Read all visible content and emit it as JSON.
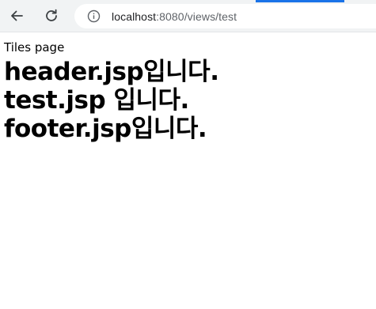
{
  "browser": {
    "url_host": "localhost",
    "url_rest": ":8080/views/test",
    "accent_color": "#1a73e8",
    "icons": {
      "back": "back-arrow-icon",
      "reload": "reload-icon",
      "site_info": "info-circle-icon"
    }
  },
  "page": {
    "tiles_label": "Tiles page",
    "header_text": "header.jsp입니다.",
    "body_text": "test.jsp 입니다.",
    "footer_text": "footer.jsp입니다."
  }
}
